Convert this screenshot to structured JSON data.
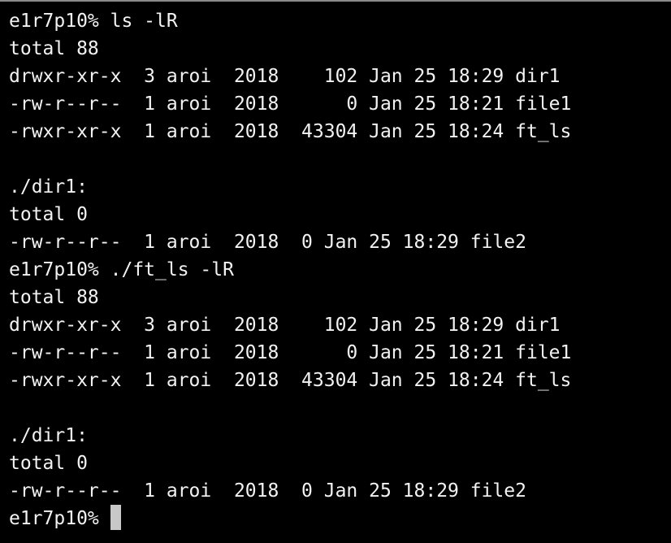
{
  "terminal": {
    "lines": [
      "e1r7p10% ls -lR",
      "total 88",
      "drwxr-xr-x  3 aroi  2018    102 Jan 25 18:29 dir1",
      "-rw-r--r--  1 aroi  2018      0 Jan 25 18:21 file1",
      "-rwxr-xr-x  1 aroi  2018  43304 Jan 25 18:24 ft_ls",
      "",
      "./dir1:",
      "total 0",
      "-rw-r--r--  1 aroi  2018  0 Jan 25 18:29 file2",
      "e1r7p10% ./ft_ls -lR",
      "total 88",
      "drwxr-xr-x  3 aroi  2018    102 Jan 25 18:29 dir1",
      "-rw-r--r--  1 aroi  2018      0 Jan 25 18:21 file1",
      "-rwxr-xr-x  1 aroi  2018  43304 Jan 25 18:24 ft_ls",
      "",
      "./dir1:",
      "total 0",
      "-rw-r--r--  1 aroi  2018  0 Jan 25 18:29 file2"
    ],
    "prompt": "e1r7p10% ",
    "colors": {
      "background": "#000000",
      "text": "#f2f2f2",
      "cursor": "#c8c8c8"
    }
  }
}
